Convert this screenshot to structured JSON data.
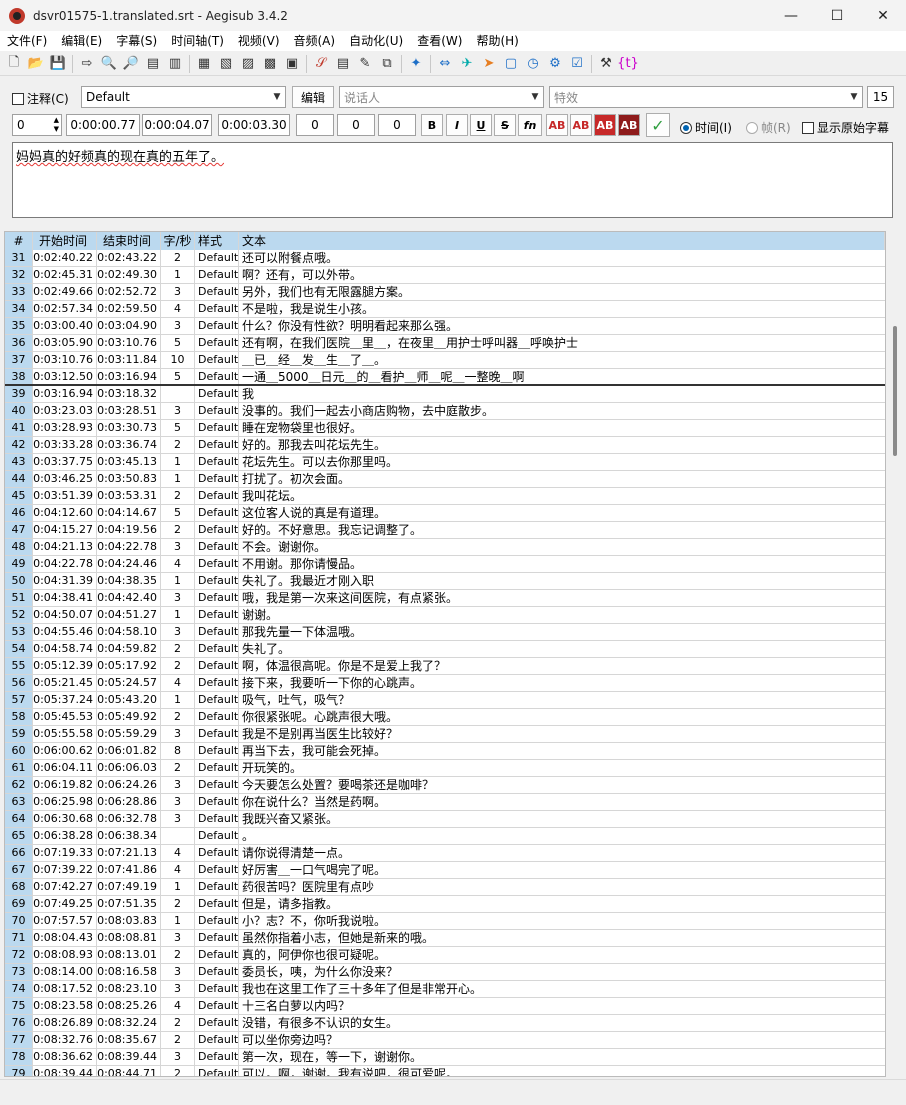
{
  "window": {
    "title": "dsvr01575-1.translated.srt - Aegisub 3.4.2",
    "buttons": [
      "—",
      "☐",
      "✕"
    ]
  },
  "menu": [
    "文件(F)",
    "编辑(E)",
    "字幕(S)",
    "时间轴(T)",
    "视频(V)",
    "音频(A)",
    "自动化(U)",
    "查看(W)",
    "帮助(H)"
  ],
  "editor": {
    "comment_label": "注释(C)",
    "style_value": "Default",
    "edit_button": "编辑",
    "actor_placeholder": "说话人",
    "effect_placeholder": "特效",
    "margin_value": "15",
    "layer": "0",
    "start_time": "0:00:00.77",
    "end_time": "0:00:04.07",
    "duration": "0:00:03.30",
    "margin_l": "0",
    "margin_r": "0",
    "margin_v": "0",
    "format_buttons": [
      "B",
      "I",
      "U",
      "S",
      "fn"
    ],
    "color_buttons": [
      "AB",
      "AB",
      "AB",
      "AB"
    ],
    "time_radio": "时间(I)",
    "frame_radio": "帧(R)",
    "show_original": "显示原始字幕",
    "text": "妈妈真的好频真的现在真的五年了。"
  },
  "grid": {
    "headers": [
      "#",
      "开始时间",
      "结束时间",
      "字/秒",
      "样式",
      "文本"
    ],
    "rows": [
      [
        "31",
        "0:02:40.22",
        "0:02:43.22",
        "2",
        "Default",
        "还可以附餐点哦。"
      ],
      [
        "32",
        "0:02:45.31",
        "0:02:49.30",
        "1",
        "Default",
        "啊？还有，可以外带。"
      ],
      [
        "33",
        "0:02:49.66",
        "0:02:52.72",
        "3",
        "Default",
        "另外，我们也有无限露腿方案。"
      ],
      [
        "34",
        "0:02:57.34",
        "0:02:59.50",
        "4",
        "Default",
        "不是啦，我是说生小孩。"
      ],
      [
        "35",
        "0:03:00.40",
        "0:03:04.90",
        "3",
        "Default",
        "什么？你没有性欲？明明看起来那么强。"
      ],
      [
        "36",
        "0:03:05.90",
        "0:03:10.76",
        "5",
        "Default",
        "还有啊，在我们医院＿里＿，在夜里＿用护士呼叫器＿呼唤护士"
      ],
      [
        "37",
        "0:03:10.76",
        "0:03:11.84",
        "10",
        "Default",
        "＿已＿经＿发＿生＿了＿。"
      ],
      [
        "38",
        "0:03:12.50",
        "0:03:16.94",
        "5",
        "Default",
        "一通＿5000＿日元＿的＿看护＿师＿呢＿一整晚＿啊"
      ],
      [
        "39",
        "0:03:16.94",
        "0:03:18.32",
        "",
        "Default",
        "我"
      ],
      [
        "40",
        "0:03:23.03",
        "0:03:28.51",
        "3",
        "Default",
        "没事的。我们一起去小商店购物，去中庭散步。"
      ],
      [
        "41",
        "0:03:28.93",
        "0:03:30.73",
        "5",
        "Default",
        "睡在宠物袋里也很好。"
      ],
      [
        "42",
        "0:03:33.28",
        "0:03:36.74",
        "2",
        "Default",
        "好的。那我去叫花坛先生。"
      ],
      [
        "43",
        "0:03:37.75",
        "0:03:45.13",
        "1",
        "Default",
        "花坛先生。可以去你那里吗。"
      ],
      [
        "44",
        "0:03:46.25",
        "0:03:50.83",
        "1",
        "Default",
        "打扰了。初次会面。"
      ],
      [
        "45",
        "0:03:51.39",
        "0:03:53.31",
        "2",
        "Default",
        "我叫花坛。"
      ],
      [
        "46",
        "0:04:12.60",
        "0:04:14.67",
        "5",
        "Default",
        "这位客人说的真是有道理。"
      ],
      [
        "47",
        "0:04:15.27",
        "0:04:19.56",
        "2",
        "Default",
        "好的。不好意思。我忘记调整了。"
      ],
      [
        "48",
        "0:04:21.13",
        "0:04:22.78",
        "3",
        "Default",
        "不会。谢谢你。"
      ],
      [
        "49",
        "0:04:22.78",
        "0:04:24.46",
        "4",
        "Default",
        "不用谢。那你请慢品。"
      ],
      [
        "50",
        "0:04:31.39",
        "0:04:38.35",
        "1",
        "Default",
        "失礼了。我最近才刚入职"
      ],
      [
        "51",
        "0:04:38.41",
        "0:04:42.40",
        "3",
        "Default",
        "哦，我是第一次来这间医院，有点紧张。"
      ],
      [
        "52",
        "0:04:50.07",
        "0:04:51.27",
        "1",
        "Default",
        "谢谢。"
      ],
      [
        "53",
        "0:04:55.46",
        "0:04:58.10",
        "3",
        "Default",
        "那我先量一下体温哦。"
      ],
      [
        "54",
        "0:04:58.74",
        "0:04:59.82",
        "2",
        "Default",
        "失礼了。"
      ],
      [
        "55",
        "0:05:12.39",
        "0:05:17.92",
        "2",
        "Default",
        "啊，体温很高呢。你是不是爱上我了？"
      ],
      [
        "56",
        "0:05:21.45",
        "0:05:24.57",
        "4",
        "Default",
        "接下来，我要听一下你的心跳声。"
      ],
      [
        "57",
        "0:05:37.24",
        "0:05:43.20",
        "1",
        "Default",
        "吸气，吐气，吸气？"
      ],
      [
        "58",
        "0:05:45.53",
        "0:05:49.92",
        "2",
        "Default",
        "你很紧张呢。心跳声很大哦。"
      ],
      [
        "59",
        "0:05:55.58",
        "0:05:59.29",
        "3",
        "Default",
        "我是不是别再当医生比较好？"
      ],
      [
        "60",
        "0:06:00.62",
        "0:06:01.82",
        "8",
        "Default",
        "再当下去，我可能会死掉。"
      ],
      [
        "61",
        "0:06:04.11",
        "0:06:06.03",
        "2",
        "Default",
        "开玩笑的。"
      ],
      [
        "62",
        "0:06:19.82",
        "0:06:24.26",
        "3",
        "Default",
        "今天要怎么处置？要喝茶还是咖啡？"
      ],
      [
        "63",
        "0:06:25.98",
        "0:06:28.86",
        "3",
        "Default",
        "你在说什么？当然是药啊。"
      ],
      [
        "64",
        "0:06:30.68",
        "0:06:32.78",
        "3",
        "Default",
        "我既兴奋又紧张。"
      ],
      [
        "65",
        "0:06:38.28",
        "0:06:38.34",
        "",
        "Default",
        "。"
      ],
      [
        "66",
        "0:07:19.33",
        "0:07:21.13",
        "4",
        "Default",
        "请你说得清楚一点。"
      ],
      [
        "67",
        "0:07:39.22",
        "0:07:41.86",
        "4",
        "Default",
        "好厉害＿一口气喝完了呢。"
      ],
      [
        "68",
        "0:07:42.27",
        "0:07:49.19",
        "1",
        "Default",
        "药很苦吗？医院里有点吵"
      ],
      [
        "69",
        "0:07:49.25",
        "0:07:51.35",
        "2",
        "Default",
        "但是，请多指教。"
      ],
      [
        "70",
        "0:07:57.57",
        "0:08:03.83",
        "1",
        "Default",
        "小？志？不，你听我说啦。"
      ],
      [
        "71",
        "0:08:04.43",
        "0:08:08.81",
        "3",
        "Default",
        "虽然你指着小志，但她是新来的哦。"
      ],
      [
        "72",
        "0:08:08.93",
        "0:08:13.01",
        "2",
        "Default",
        "真的，阿伊你也很可疑呢。"
      ],
      [
        "73",
        "0:08:14.00",
        "0:08:16.58",
        "3",
        "Default",
        "委员长，咦，为什么你没来？"
      ],
      [
        "74",
        "0:08:17.52",
        "0:08:23.10",
        "3",
        "Default",
        "我也在这里工作了三十多年了但是非常开心。"
      ],
      [
        "75",
        "0:08:23.58",
        "0:08:25.26",
        "4",
        "Default",
        "十三名白萝以内吗？"
      ],
      [
        "76",
        "0:08:26.89",
        "0:08:32.24",
        "2",
        "Default",
        "没错，有很多不认识的女生。"
      ],
      [
        "77",
        "0:08:32.76",
        "0:08:35.67",
        "2",
        "Default",
        "可以坐你旁边吗？"
      ],
      [
        "78",
        "0:08:36.62",
        "0:08:39.44",
        "3",
        "Default",
        "第一次，现在，等一下，谢谢你。"
      ],
      [
        "79",
        "0:08:39.44",
        "0:08:44.71",
        "2",
        "Default",
        "可以。啊，谢谢。我有说吧，很可爱呢。"
      ]
    ]
  }
}
